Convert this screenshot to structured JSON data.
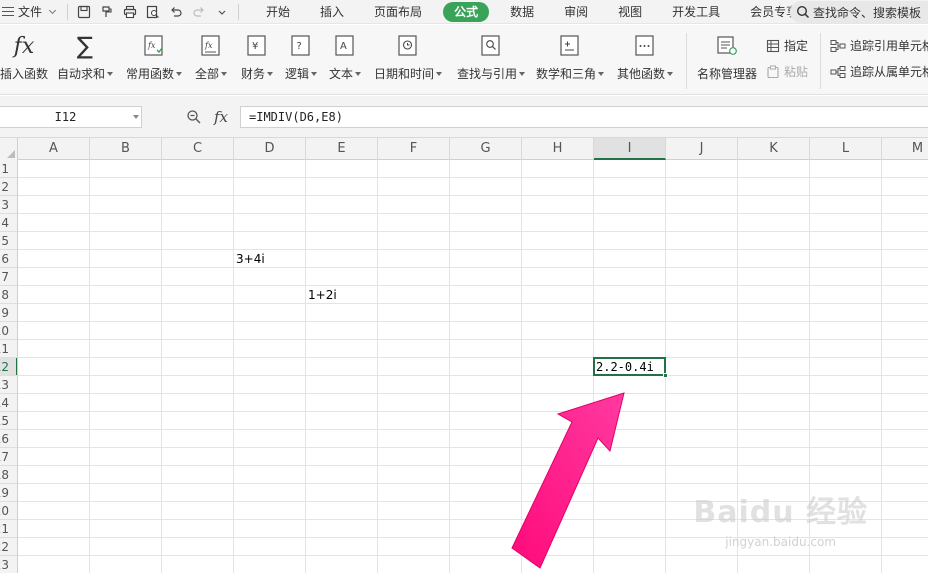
{
  "menubar": {
    "file_label": "文件",
    "tabs": [
      {
        "label": "开始",
        "active": false
      },
      {
        "label": "插入",
        "active": false
      },
      {
        "label": "页面布局",
        "active": false
      },
      {
        "label": "公式",
        "active": true
      },
      {
        "label": "数据",
        "active": false
      },
      {
        "label": "审阅",
        "active": false
      },
      {
        "label": "视图",
        "active": false
      },
      {
        "label": "开发工具",
        "active": false
      },
      {
        "label": "会员专享",
        "active": false
      }
    ],
    "search_placeholder": "查找命令、搜索模板"
  },
  "ribbon": {
    "insert_function": "插入函数",
    "autosum": "自动求和",
    "common_functions": "常用函数",
    "all": "全部",
    "financial": "财务",
    "logical": "逻辑",
    "text": "文本",
    "datetime": "日期和时间",
    "lookup": "查找与引用",
    "math": "数学和三角",
    "other": "其他函数",
    "name_manager": "名称管理器",
    "define": "指定",
    "paste": "粘贴",
    "trace_precedents": "追踪引用单元格",
    "trace_dependents": "追踪从属单元格"
  },
  "formula_bar": {
    "name_box": "I12",
    "fx_label": "fx",
    "formula": "=IMDIV(D6,E8)"
  },
  "sheet": {
    "columns": [
      "A",
      "B",
      "C",
      "D",
      "E",
      "F",
      "G",
      "H",
      "I",
      "J",
      "K",
      "L",
      "M"
    ],
    "rows": [
      "1",
      "2",
      "3",
      "4",
      "5",
      "6",
      "7",
      "8",
      "9",
      "10",
      "11",
      "12",
      "13",
      "14",
      "15",
      "16",
      "17",
      "18",
      "19",
      "20",
      "21",
      "22",
      "23"
    ],
    "selected_column": "I",
    "selected_row": "12",
    "cells": {
      "D6": "3+4i",
      "E8": "1+2i",
      "I12": "2.2-0.4i"
    }
  },
  "watermark": {
    "main": "Baidu 经验",
    "sub": "jingyan.baidu.com"
  },
  "colors": {
    "accent": "#3aa35a",
    "selection": "#217346",
    "arrow": "#ff1a8c"
  }
}
